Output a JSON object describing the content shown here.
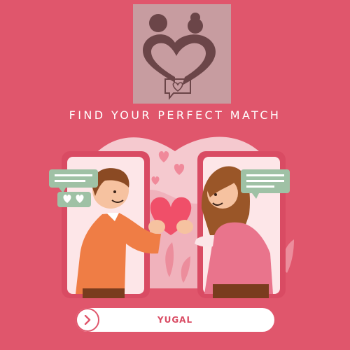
{
  "headline": "FIND YOUR PERFECT MATCH",
  "cta": {
    "label": "YUGAL",
    "icon": "chevron-right-icon"
  },
  "colors": {
    "background": "#e0566c",
    "logo_box": "#c79ca0",
    "logo_ink": "#6b4548",
    "accent": "#e0566c"
  },
  "logo": {
    "icons": [
      "person-icon",
      "person-icon",
      "heart-icon",
      "chat-heart-icon"
    ]
  },
  "illustration": {
    "icons": [
      "phone-icon",
      "phone-icon",
      "man-icon",
      "woman-icon",
      "heart-icon",
      "chat-bubble-icon",
      "chat-hearts-bubble-icon"
    ]
  }
}
